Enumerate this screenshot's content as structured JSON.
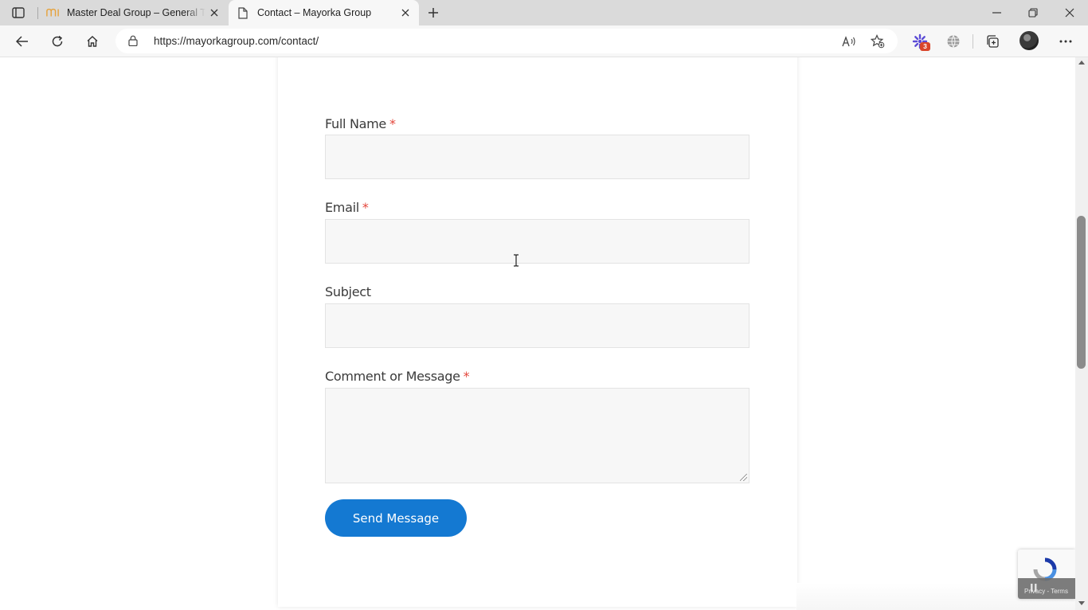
{
  "browser": {
    "tabs": [
      {
        "title": "Master Deal Group – General Tra",
        "active": false,
        "favicon": "md-logo-icon"
      },
      {
        "title": "Contact – Mayorka Group",
        "active": true,
        "favicon": "page-icon"
      }
    ],
    "url": "https://mayorkagroup.com/contact/",
    "extension_badge": "3"
  },
  "form": {
    "full_name_label": "Full Name",
    "email_label": "Email",
    "subject_label": "Subject",
    "message_label": "Comment or Message",
    "required_mark": "*",
    "submit_label": "Send Message"
  },
  "recaptcha": {
    "footer_text": "Privacy - Terms"
  },
  "colors": {
    "accent": "#1479d2",
    "required": "#e4463b",
    "field_bg": "#f7f7f7"
  }
}
